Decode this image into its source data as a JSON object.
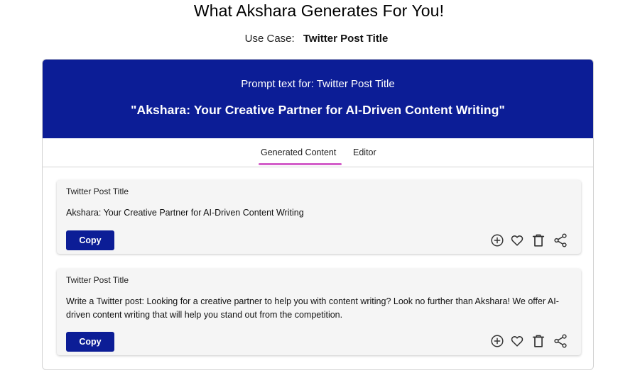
{
  "header": {
    "title": "What Akshara Generates For You!",
    "use_case_label": "Use Case:",
    "use_case_value": "Twitter Post Title"
  },
  "banner": {
    "prompt_label": "Prompt text for: Twitter Post Title",
    "prompt_text": "\"Akshara: Your Creative Partner for AI-Driven Content Writing\"",
    "background": "#0c1d96"
  },
  "tabs": [
    {
      "label": "Generated Content",
      "active": true
    },
    {
      "label": "Editor",
      "active": false
    }
  ],
  "accent_color": "#d35ec9",
  "results": [
    {
      "label": "Twitter Post Title",
      "text": "Akshara: Your Creative Partner for AI-Driven Content Writing",
      "copy_label": "Copy"
    },
    {
      "label": "Twitter Post Title",
      "text": "Write a Twitter post: Looking for a creative partner to help you with content writing? Look no further than Akshara! We offer AI-driven content writing that will help you stand out from the competition.",
      "copy_label": "Copy"
    }
  ],
  "icons": [
    "add-circle-icon",
    "heart-icon",
    "trash-icon",
    "share-icon"
  ]
}
